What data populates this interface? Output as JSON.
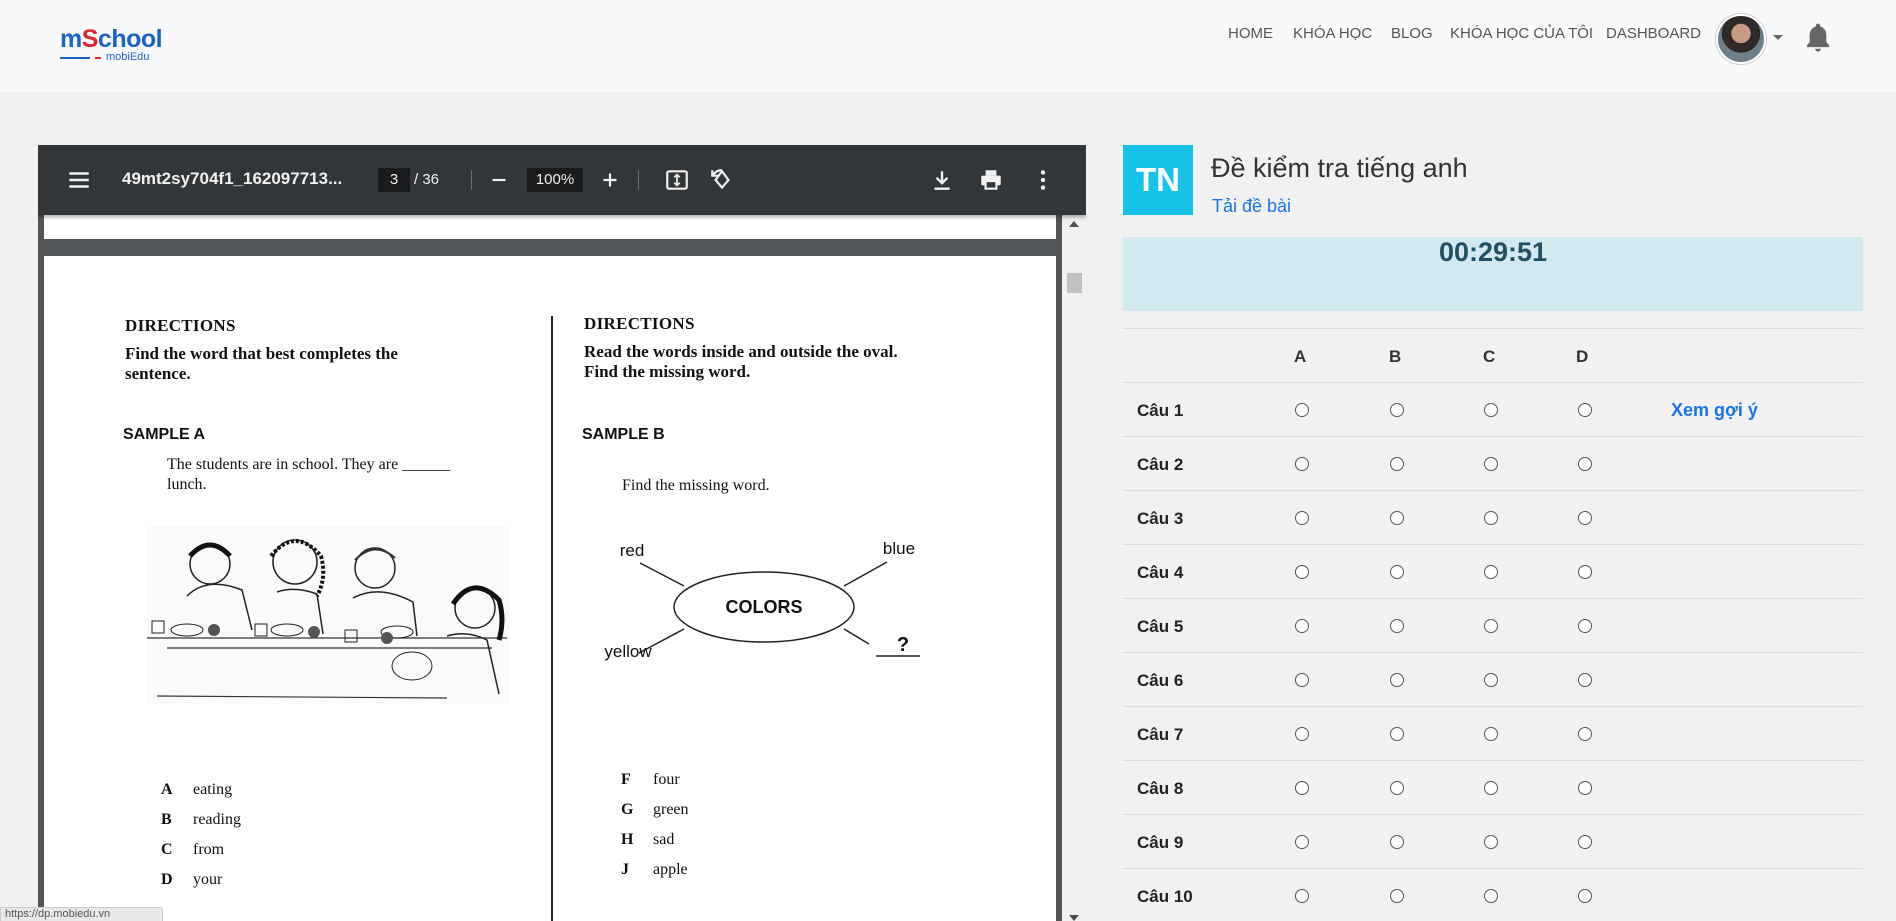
{
  "header": {
    "logo_main_prefix": "m",
    "logo_main_s": "S",
    "logo_main_rest": "chool",
    "logo_sub": "mobiEdu",
    "nav": [
      "HOME",
      "KHÓA HỌC",
      "BLOG",
      "KHÓA HỌC CỦA TÔI",
      "DASHBOARD"
    ],
    "avatar_icon": "user-avatar",
    "bell_icon": "bell-icon"
  },
  "pdf": {
    "file_name": "49mt2sy704f1_162097713...",
    "page_current": "3",
    "page_total": "/ 36",
    "zoom": "100%",
    "left_col": {
      "directions": "DIRECTIONS",
      "instructions": [
        "Find the word that best completes the",
        "sentence."
      ],
      "sample": "SAMPLE A",
      "stem": [
        "The students are in school. They are ______",
        "lunch."
      ],
      "options": [
        {
          "letter": "A",
          "text": "eating"
        },
        {
          "letter": "B",
          "text": "reading"
        },
        {
          "letter": "C",
          "text": "from"
        },
        {
          "letter": "D",
          "text": "your"
        }
      ]
    },
    "right_col": {
      "directions": "DIRECTIONS",
      "instructions": [
        "Read the words inside and outside the oval.",
        "Find the missing word."
      ],
      "sample": "SAMPLE B",
      "stem": "Find the missing word.",
      "diagram": {
        "center": "COLORS",
        "top_left": "red",
        "top_right": "blue",
        "bottom_left": "yellow",
        "bottom_right": "?"
      },
      "options": [
        {
          "letter": "F",
          "text": "four"
        },
        {
          "letter": "G",
          "text": "green"
        },
        {
          "letter": "H",
          "text": "sad"
        },
        {
          "letter": "J",
          "text": "apple"
        }
      ]
    },
    "status_url": "https://dp.mobiedu.vn"
  },
  "test": {
    "badge": "TN",
    "title": "Đề kiểm tra tiếng anh",
    "download_link": "Tải đề bài",
    "timer": "00:29:51",
    "columns": [
      "A",
      "B",
      "C",
      "D"
    ],
    "questions": [
      {
        "label": "Câu 1",
        "hint": "Xem gợi ý"
      },
      {
        "label": "Câu 2"
      },
      {
        "label": "Câu 3"
      },
      {
        "label": "Câu 4"
      },
      {
        "label": "Câu 5"
      },
      {
        "label": "Câu 6"
      },
      {
        "label": "Câu 7"
      },
      {
        "label": "Câu 8"
      },
      {
        "label": "Câu 9"
      },
      {
        "label": "Câu 10"
      }
    ]
  }
}
